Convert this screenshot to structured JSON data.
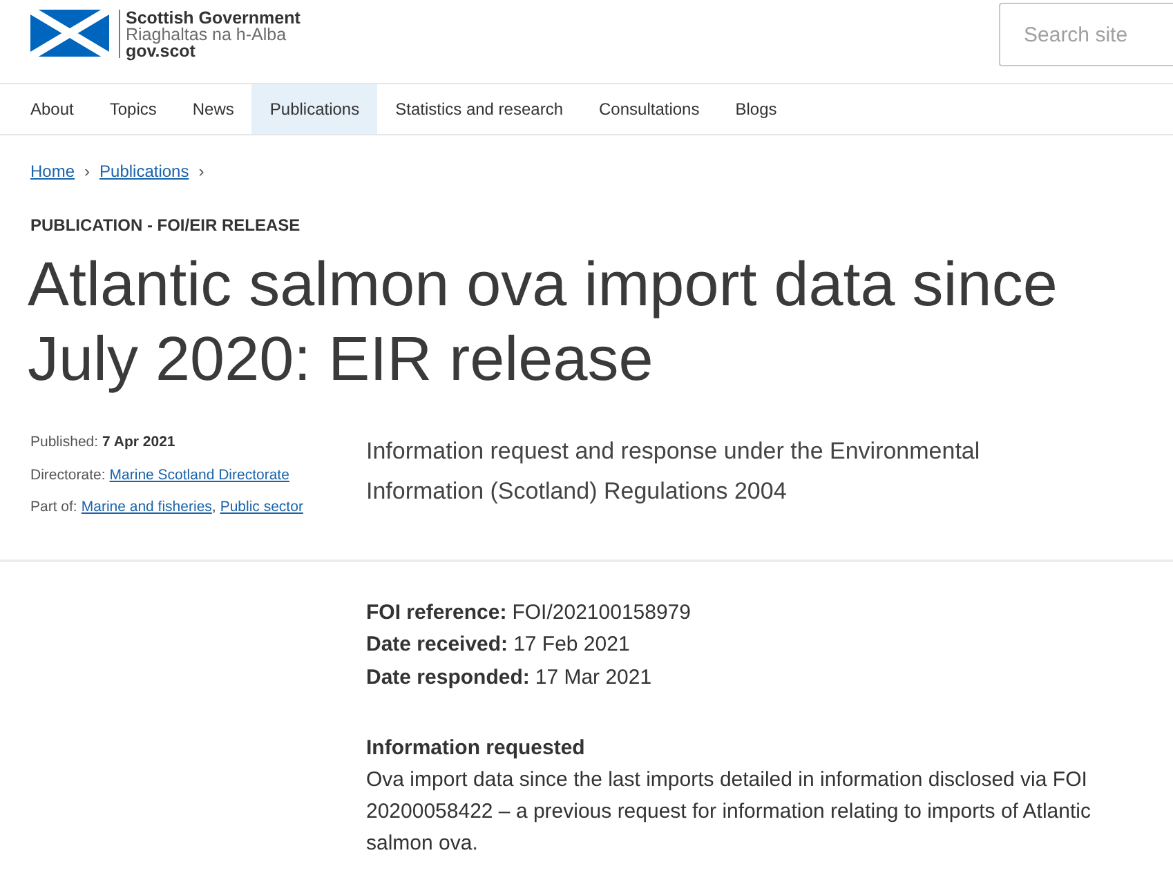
{
  "header": {
    "logo": {
      "name": "Scottish Government",
      "gaelic_name": "Riaghaltas na h-Alba",
      "domain": "gov.scot"
    },
    "search": {
      "placeholder": "Search site"
    }
  },
  "nav": [
    {
      "label": "About",
      "selected": false
    },
    {
      "label": "Topics",
      "selected": false
    },
    {
      "label": "News",
      "selected": false
    },
    {
      "label": "Publications",
      "selected": true
    },
    {
      "label": "Statistics and research",
      "selected": false
    },
    {
      "label": "Consultations",
      "selected": false
    },
    {
      "label": "Blogs",
      "selected": false
    }
  ],
  "breadcrumb": [
    {
      "label": "Home",
      "separator": "›"
    },
    {
      "label": "Publications",
      "separator": "›"
    }
  ],
  "label": "PUBLICATION - FOI/EIR RELEASE",
  "title": "Atlantic salmon ova import data since July 2020: EIR release",
  "meta": [
    {
      "kind": "text",
      "label": "Published:",
      "value": "7 Apr 2021"
    },
    {
      "kind": "links",
      "label": "Directorate:",
      "links": [
        {
          "label": "Marine Scotland Directorate"
        }
      ]
    },
    {
      "kind": "links",
      "label": "Part of:",
      "links": [
        {
          "label": "Marine and fisheries",
          "separator": ","
        },
        {
          "label": "Public sector"
        }
      ]
    }
  ],
  "summary": "Information request and response under the Environmental Information (Scotland) Regulations 2004",
  "details": [
    {
      "label": "FOI reference:",
      "value": "FOI/202100158979"
    },
    {
      "label": "Date received:",
      "value": "17 Feb 2021"
    },
    {
      "label": "Date responded:",
      "value": "17 Mar 2021"
    }
  ],
  "sections": [
    {
      "heading": "Information requested",
      "body": "Ova import data since the last imports detailed in information disclosed via FOI 20200058422 – a previous request for information relating to imports of Atlantic salmon ova."
    }
  ]
}
